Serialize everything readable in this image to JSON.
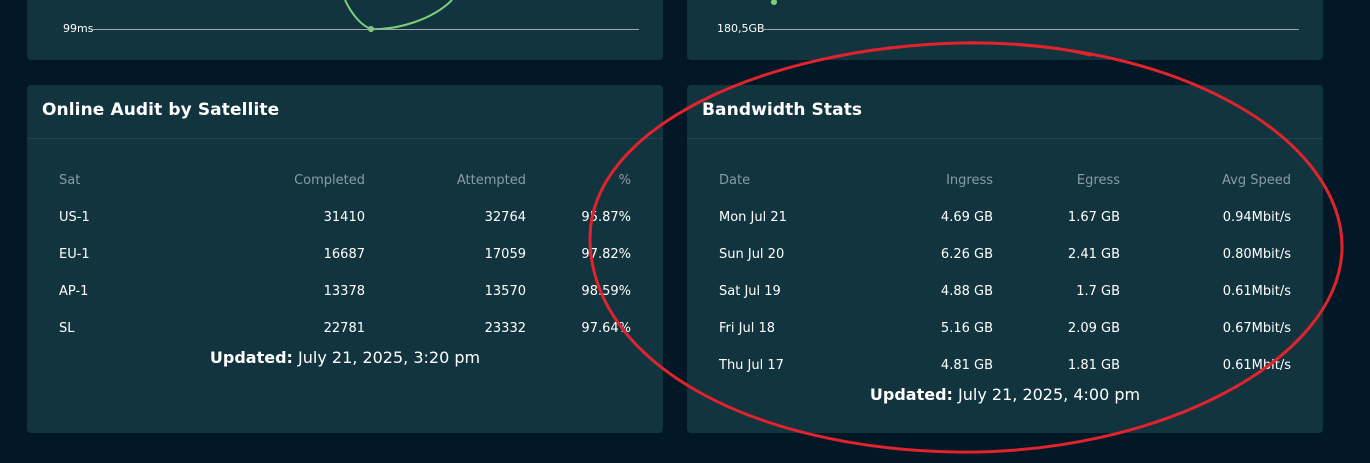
{
  "top_left_card": {
    "axis_label": "99ms"
  },
  "top_right_card": {
    "axis_label": "180,5GB"
  },
  "audit": {
    "title": "Online Audit by Satellite",
    "columns": [
      "Sat",
      "Completed",
      "Attempted",
      "%"
    ],
    "rows": [
      [
        "US-1",
        "31410",
        "32764",
        "95.87%"
      ],
      [
        "EU-1",
        "16687",
        "17059",
        "97.82%"
      ],
      [
        "AP-1",
        "13378",
        "13570",
        "98.59%"
      ],
      [
        "SL",
        "22781",
        "23332",
        "97.64%"
      ]
    ],
    "updated_label": "Updated:",
    "updated_value": "July 21, 2025, 3:20 pm"
  },
  "bandwidth": {
    "title": "Bandwidth Stats",
    "columns": [
      "Date",
      "Ingress",
      "Egress",
      "Avg Speed"
    ],
    "rows": [
      [
        "Mon Jul 21",
        "4.69 GB",
        "1.67 GB",
        "0.94Mbit/s"
      ],
      [
        "Sun Jul 20",
        "6.26 GB",
        "2.41 GB",
        "0.80Mbit/s"
      ],
      [
        "Sat Jul 19",
        "4.88 GB",
        "1.7 GB",
        "0.61Mbit/s"
      ],
      [
        "Fri Jul 18",
        "5.16 GB",
        "2.09 GB",
        "0.67Mbit/s"
      ],
      [
        "Thu Jul 17",
        "4.81 GB",
        "1.81 GB",
        "0.61Mbit/s"
      ]
    ],
    "updated_label": "Updated:",
    "updated_value": "July 21, 2025, 4:00 pm"
  },
  "colors": {
    "background": "#021826",
    "card": "#12343f",
    "chart_line": "#7ccf7a",
    "annotation": "#e0232c"
  }
}
